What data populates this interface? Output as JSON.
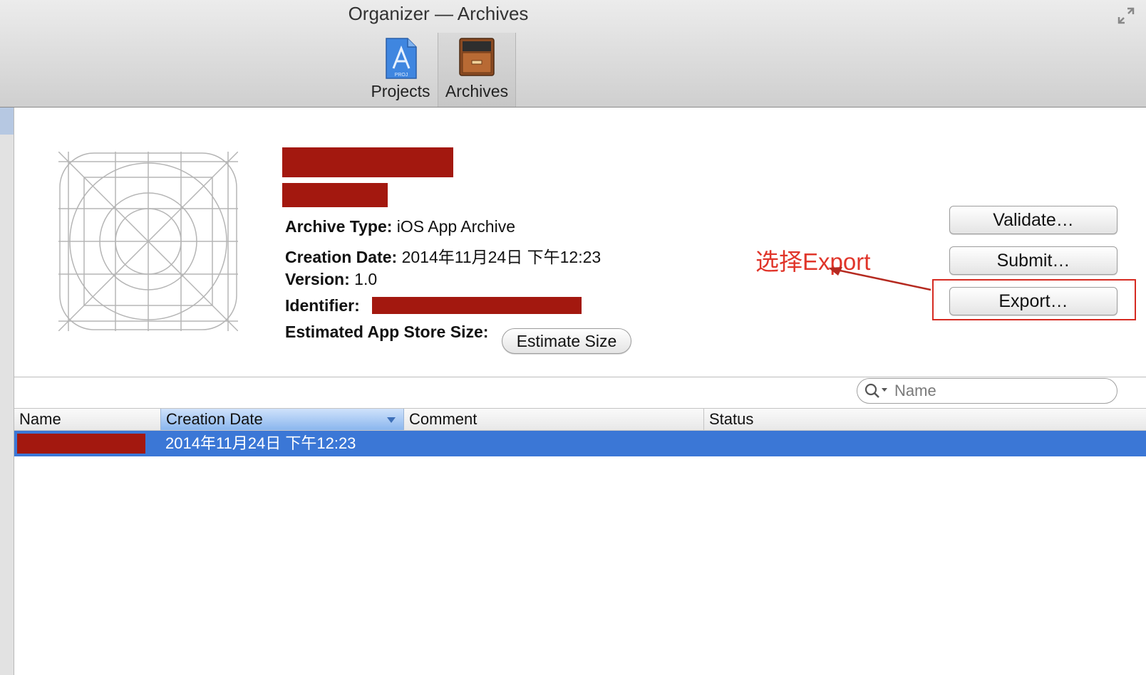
{
  "window": {
    "title": "Organizer — Archives"
  },
  "toolbar": {
    "projects_label": "Projects",
    "archives_label": "Archives"
  },
  "archive": {
    "type_label": "Archive Type:",
    "type_value": "iOS App Archive",
    "date_label": "Creation Date:",
    "date_value": "2014年11月24日 下午12:23",
    "version_label": "Version:",
    "version_value": "1.0",
    "identifier_label": "Identifier:",
    "size_label": "Estimated App Store Size:",
    "estimate_button": "Estimate Size"
  },
  "actions": {
    "validate": "Validate…",
    "submit": "Submit…",
    "export": "Export…"
  },
  "annotation": {
    "text": "选择Export",
    "color": "#e0352a"
  },
  "search": {
    "placeholder": "Name"
  },
  "table": {
    "columns": [
      "Name",
      "Creation Date",
      "Comment",
      "Status"
    ],
    "rows": [
      {
        "creation_date": "2014年11月24日 下午12:23"
      }
    ]
  },
  "colors": {
    "selection": "#3b77d6",
    "redaction": "#a3180f",
    "highlight": "#d62b22"
  }
}
